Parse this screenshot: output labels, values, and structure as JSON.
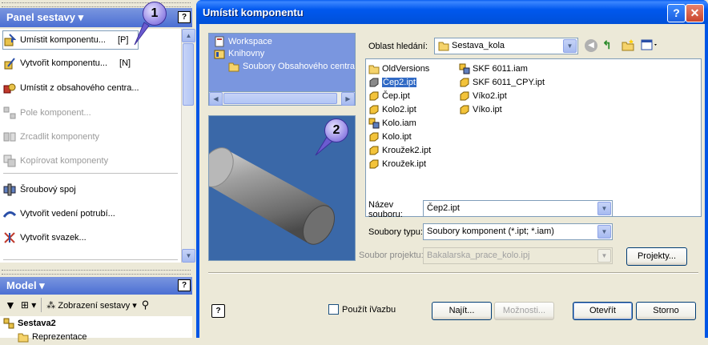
{
  "left_panel": {
    "title": "Panel sestavy",
    "help": "?",
    "commands": [
      {
        "label": "Umístit komponentu...",
        "key": "[P]",
        "icon": "place-component-icon",
        "enabled": true,
        "selected": true
      },
      {
        "label": "Vytvořit komponentu...",
        "key": "[N]",
        "icon": "create-component-icon",
        "enabled": true
      },
      {
        "label": "Umístit z obsahového centra...",
        "key": "",
        "icon": "content-center-icon",
        "enabled": true
      },
      {
        "label": "Pole komponent...",
        "key": "",
        "icon": "pattern-icon",
        "enabled": false
      },
      {
        "label": "Zrcadlit komponenty",
        "key": "",
        "icon": "mirror-icon",
        "enabled": false
      },
      {
        "label": "Kopírovat komponenty",
        "key": "",
        "icon": "copy-icon",
        "enabled": false
      },
      {
        "label": "Šroubový spoj",
        "key": "",
        "icon": "bolted-connection-icon",
        "enabled": true
      },
      {
        "label": "Vytvořit vedení potrubí...",
        "key": "",
        "icon": "tube-pipe-icon",
        "enabled": true
      },
      {
        "label": "Vytvořit svazek...",
        "key": "",
        "icon": "harness-icon",
        "enabled": true
      }
    ],
    "model": {
      "title": "Model",
      "help": "?",
      "view_label": "Zobrazení sestavy",
      "root": "Sestava2",
      "child": "Reprezentace"
    }
  },
  "dialog": {
    "title": "Umístit komponentu",
    "help_btn": "?",
    "close_btn": "✕",
    "locations": [
      {
        "label": "Workspace",
        "icon": "workspace-icon"
      },
      {
        "label": "Knihovny",
        "icon": "libraries-icon"
      },
      {
        "label": "Soubory Obsahového centra",
        "icon": "folder-icon"
      }
    ],
    "search_label": "Oblast hledání:",
    "search_value": "Sestava_kola",
    "files_col1": [
      {
        "name": "OldVersions",
        "type": "folder"
      },
      {
        "name": "Čep2.ipt",
        "type": "part",
        "selected": true
      },
      {
        "name": "Čep.ipt",
        "type": "part"
      },
      {
        "name": "Kolo2.ipt",
        "type": "part"
      },
      {
        "name": "Kolo.iam",
        "type": "assembly"
      },
      {
        "name": "Kolo.ipt",
        "type": "part"
      },
      {
        "name": "Kroužek2.ipt",
        "type": "part"
      },
      {
        "name": "Kroužek.ipt",
        "type": "part"
      }
    ],
    "files_col2": [
      {
        "name": "SKF 6011.iam",
        "type": "assembly"
      },
      {
        "name": "SKF 6011_CPY.ipt",
        "type": "part"
      },
      {
        "name": "Víko2.ipt",
        "type": "part"
      },
      {
        "name": "Víko.ipt",
        "type": "part"
      }
    ],
    "filename_label": "Název souboru:",
    "filename_value": "Čep2.ipt",
    "filetype_label": "Soubory typu:",
    "filetype_value": "Soubory komponent (*.ipt; *.iam)",
    "project_label": "Soubor projektu:",
    "project_value": "Bakalarska_prace_kolo.ipj",
    "projects_btn": "Projekty...",
    "use_ivazbu": "Použít iVazbu",
    "find_btn": "Najít...",
    "options_btn": "Možnosti...",
    "open_btn": "Otevřít",
    "cancel_btn": "Storno"
  },
  "callouts": [
    "1",
    "2"
  ]
}
